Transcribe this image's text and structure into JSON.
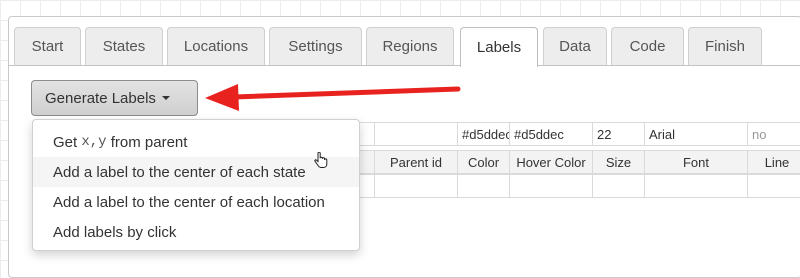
{
  "tabs": [
    "Start",
    "States",
    "Locations",
    "Settings",
    "Regions",
    "Labels",
    "Data",
    "Code",
    "Finish"
  ],
  "active_tab": "Labels",
  "generate_button": {
    "label": "Generate Labels"
  },
  "dropdown": {
    "items": [
      {
        "prefix": "Get ",
        "code": "x,y",
        "suffix": " from parent"
      },
      {
        "label": "Add a label to the center of each state"
      },
      {
        "label": "Add a label to the center of each location"
      },
      {
        "label": "Add labels by click"
      }
    ],
    "hovered_index": 1
  },
  "label_table": {
    "default_row": {
      "color": "#d5ddec",
      "hover_color": "#d5ddec",
      "size": "22",
      "font": "Arial",
      "line": "no"
    },
    "headers": {
      "parent_id": "Parent id",
      "color": "Color",
      "hover_color": "Hover Color",
      "size": "Size",
      "font": "Font",
      "line": "Line"
    }
  },
  "colors": {
    "arrow": "#e8231f"
  }
}
